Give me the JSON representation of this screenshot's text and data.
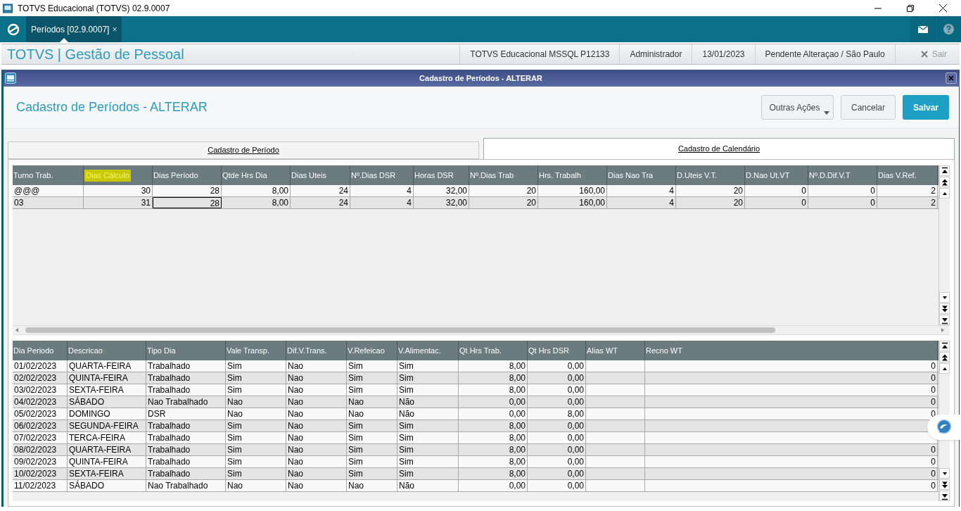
{
  "window": {
    "title": "TOTVS Educacional (TOTVS) 02.9.0007"
  },
  "app_tabs": [
    {
      "label": "Períodos [02.9.0007]",
      "close": "×",
      "selected": true
    }
  ],
  "header": {
    "title": "TOTVS | Gestão de Pessoal",
    "info": [
      "TOTVS Educacional MSSQL P12133",
      "Administrador",
      "13/01/2023",
      "Pendente Alteraçao / São Paulo"
    ],
    "exit": "Sair"
  },
  "dialog": {
    "title": "Cadastro de Períodos - ALTERAR",
    "heading": "Cadastro de Períodos - ALTERAR",
    "buttons": [
      {
        "label": "Outras Ações",
        "kind": "menu"
      },
      {
        "label": "Cancelar",
        "kind": "plain"
      },
      {
        "label": "Salvar",
        "kind": "primary"
      }
    ],
    "tabs": [
      {
        "label": "Cadastro de Período",
        "selected": false
      },
      {
        "label": "Cadastro de Calendário",
        "selected": true
      }
    ]
  },
  "period_grid": {
    "columns": [
      {
        "label": "Turno Trab.",
        "kind": "text",
        "highlighted": false
      },
      {
        "label": "Dias Cálculo",
        "kind": "number",
        "highlighted": true
      },
      {
        "label": "Dias Período",
        "kind": "number",
        "highlighted": false
      },
      {
        "label": "Qtde Hrs Dia",
        "kind": "number",
        "highlighted": false
      },
      {
        "label": "Dias Uteis",
        "kind": "number",
        "highlighted": false
      },
      {
        "label": "Nº.Dias DSR",
        "kind": "number",
        "highlighted": false
      },
      {
        "label": "Horas DSR",
        "kind": "number",
        "highlighted": false
      },
      {
        "label": "Nº.Dias Trab",
        "kind": "number",
        "highlighted": false
      },
      {
        "label": "Hrs. Trabalh",
        "kind": "number",
        "highlighted": false
      },
      {
        "label": "Dias Nao Tra",
        "kind": "number",
        "highlighted": false
      },
      {
        "label": "D.Uteis V.T.",
        "kind": "number",
        "highlighted": false
      },
      {
        "label": "D.Nao Ut.VT",
        "kind": "number",
        "highlighted": false
      },
      {
        "label": "Nº.D.Dif.V.T",
        "kind": "number",
        "highlighted": false
      },
      {
        "label": "Dias V.Ref.",
        "kind": "number",
        "highlighted": false
      }
    ],
    "rows": [
      [
        {
          "text": "@@@",
          "focused": false
        },
        {
          "text": "30",
          "focused": false
        },
        {
          "text": "28",
          "focused": false
        },
        {
          "text": "8,00",
          "focused": false
        },
        {
          "text": "24",
          "focused": false
        },
        {
          "text": "4",
          "focused": false
        },
        {
          "text": "32,00",
          "focused": false
        },
        {
          "text": "20",
          "focused": false
        },
        {
          "text": "160,00",
          "focused": false
        },
        {
          "text": "4",
          "focused": false
        },
        {
          "text": "20",
          "focused": false
        },
        {
          "text": "0",
          "focused": false
        },
        {
          "text": "0",
          "focused": false
        },
        {
          "text": "2",
          "focused": false
        }
      ],
      [
        {
          "text": "03",
          "focused": false
        },
        {
          "text": "31",
          "focused": false
        },
        {
          "text": "28",
          "focused": true
        },
        {
          "text": "8,00",
          "focused": false
        },
        {
          "text": "24",
          "focused": false
        },
        {
          "text": "4",
          "focused": false
        },
        {
          "text": "32,00",
          "focused": false
        },
        {
          "text": "20",
          "focused": false
        },
        {
          "text": "160,00",
          "focused": false
        },
        {
          "text": "4",
          "focused": false
        },
        {
          "text": "20",
          "focused": false
        },
        {
          "text": "0",
          "focused": false
        },
        {
          "text": "0",
          "focused": false
        },
        {
          "text": "2",
          "focused": false
        }
      ]
    ]
  },
  "calendar_grid": {
    "columns": [
      {
        "label": "Dia Periodo",
        "kind": "text"
      },
      {
        "label": "Descricao",
        "kind": "text"
      },
      {
        "label": "Tipo Dia",
        "kind": "text"
      },
      {
        "label": "Vale Transp.",
        "kind": "text"
      },
      {
        "label": "Dif.V.Trans.",
        "kind": "text"
      },
      {
        "label": "V.Refeicao",
        "kind": "text"
      },
      {
        "label": "V.Alimentac.",
        "kind": "text"
      },
      {
        "label": "Qt Hrs Trab.",
        "kind": "number"
      },
      {
        "label": "Qt Hrs DSR",
        "kind": "number"
      },
      {
        "label": "Alias WT",
        "kind": "text"
      },
      {
        "label": "Recno WT",
        "kind": "number"
      }
    ],
    "rows": [
      [
        "01/02/2023",
        "QUARTA-FEIRA",
        "Trabalhado",
        "Sim",
        "Nao",
        "Sim",
        "Sim",
        "8,00",
        "0,00",
        null,
        "0"
      ],
      [
        "02/02/2023",
        "QUINTA-FEIRA",
        "Trabalhado",
        "Sim",
        "Nao",
        "Sim",
        "Sim",
        "8,00",
        "0,00",
        null,
        "0"
      ],
      [
        "03/02/2023",
        "SEXTA-FEIRA",
        "Trabalhado",
        "Sim",
        "Nao",
        "Sim",
        "Sim",
        "8,00",
        "0,00",
        null,
        "0"
      ],
      [
        "04/02/2023",
        "SÁBADO",
        "Nao Trabalhado",
        "Nao",
        "Nao",
        "Nao",
        "Não",
        "0,00",
        "0,00",
        null,
        "0"
      ],
      [
        "05/02/2023",
        "DOMINGO",
        "DSR",
        "Nao",
        "Nao",
        "Nao",
        "Não",
        "0,00",
        "8,00",
        null,
        "0"
      ],
      [
        "06/02/2023",
        "SEGUNDA-FEIRA",
        "Trabalhado",
        "Sim",
        "Nao",
        "Sim",
        "Sim",
        "8,00",
        "0,00",
        null,
        null
      ],
      [
        "07/02/2023",
        "TERCA-FEIRA",
        "Trabalhado",
        "Sim",
        "Nao",
        "Sim",
        "Sim",
        "8,00",
        "0,00",
        null,
        null
      ],
      [
        "08/02/2023",
        "QUARTA-FEIRA",
        "Trabalhado",
        "Sim",
        "Nao",
        "Sim",
        "Sim",
        "8,00",
        "0,00",
        null,
        "0"
      ],
      [
        "09/02/2023",
        "QUINTA-FEIRA",
        "Trabalhado",
        "Sim",
        "Nao",
        "Sim",
        "Sim",
        "8,00",
        "0,00",
        null,
        "0"
      ],
      [
        "10/02/2023",
        "SEXTA-FEIRA",
        "Trabalhado",
        "Sim",
        "Nao",
        "Sim",
        "Sim",
        "8,00",
        "0,00",
        null,
        "0"
      ],
      [
        "11/02/2023",
        "SÁBADO",
        "Nao Trabalhado",
        "Nao",
        "Nao",
        "Nao",
        "Não",
        "0,00",
        "0,00",
        null,
        "0"
      ]
    ]
  }
}
